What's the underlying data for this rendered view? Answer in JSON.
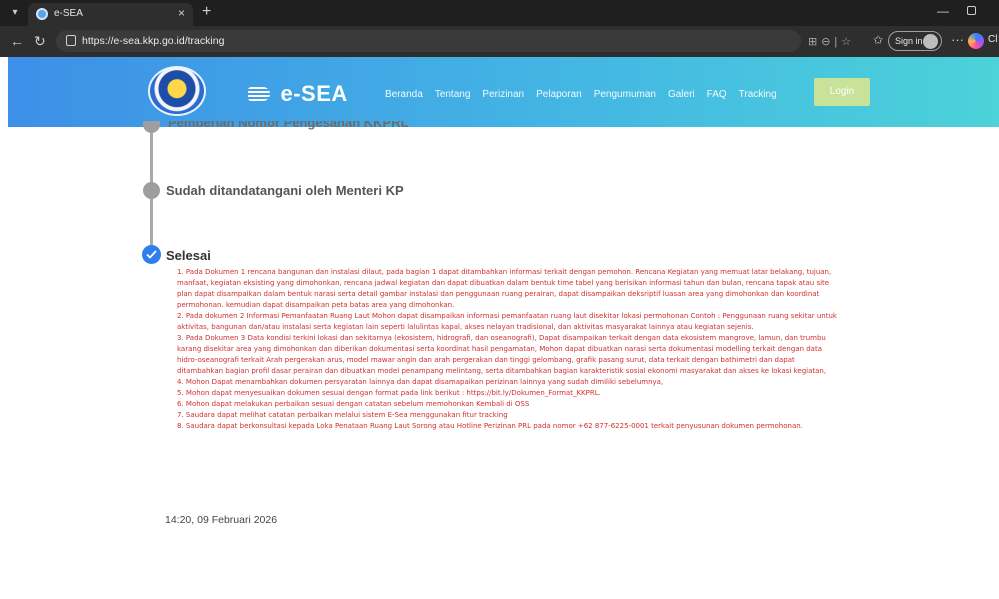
{
  "browser": {
    "tab_title": "e-SEA",
    "tab_close": "×",
    "new_tab": "+",
    "url": "https://e-sea.kkp.go.id/tracking",
    "signin_label": "Sign in",
    "copilot_label": "Cl"
  },
  "header": {
    "brand": "e-SEA",
    "nav": [
      "Beranda",
      "Tentang",
      "Perizinan",
      "Pelaporan",
      "Pengumuman",
      "Galeri",
      "FAQ",
      "Tracking"
    ],
    "login_label": "Login",
    "colors": {
      "gradient_start": "#3d8fe7",
      "gradient_end": "#4cd2d9",
      "login": "#c8e29a"
    }
  },
  "timeline": {
    "prev_step": "Pemberian Nomor Pengesahan KKPRL",
    "step_signed": "Sudah ditandatangani oleh Menteri KP",
    "step_done": "Selesai",
    "notes": [
      "1. Pada Dokumen 1 rencana bangunan dan instalasi dilaut, pada bagian 1 dapat ditambahkan informasi terkait dengan pemohon. Rencana Kegiatan yang memuat latar belakang, tujuan,",
      "manfaat, kegiatan eksisting yang dimohonkan, rencana jadwal kegiatan dan dapat dibuatkan dalam bentuk time tabel yang berisikan informasi tahun dan bulan, rencana tapak atau site",
      "plan dapat disampaikan dalam bentuk narasi serta detail gambar instalasi dan penggunaan ruang perairan, dapat disampaikan deksriptif luasan area yang dimohonkan dan koordinat",
      "permohonan. kemudian dapat disampaikan peta batas area yang dimohonkan.",
      "2. Pada dokumen 2 Informasi Pemanfaatan Ruang Laut Mohon dapat disampaikan informasi pemanfaatan ruang laut disekitar lokasi permohonan Contoh : Penggunaan ruang sekitar untuk",
      "aktivitas, bangunan dan/atau instalasi serta kegiatan lain seperti lalulintas kapal, akses nelayan tradisional, dan aktivitas masyarakat lainnya atau kegiatan sejenis.",
      "3. Pada Dokumen 3 Data kondisi terkini lokasi dan sekitarnya (ekosistem, hidrografi, dan oseanografi), Dapat disampaikan terkait dengan data ekosistem mangrove, lamun, dan trumbu",
      "karang disekitar area yang dimohonkan dan diberikan dokumentasi serta koordinat hasil pengamatan, Mohon dapat dibuatkan narasi serta dokumentasi modelling terkait dengan data",
      "hidro-oseanografi terkait Arah pergerakan arus, model mawar angin dan arah pergerakan dan tinggi gelombang, grafik pasang surut, data terkait dengan bathimetri dan dapat",
      "ditambahkan bagian profil dasar perairan dan dibuatkan model penampang melintang, serta ditambahkan bagian karakteristik sosial ekonomi masyarakat dan akses ke lokasi kegiatan,",
      "4. Mohon Dapat menambahkan dokumen persyaratan lainnya dan dapat disamapaikan perizinan lainnya yang sudah dimiliki sebelumnya,",
      "5. Mohon dapat menyesuaikan dokumen sesuai dengan format pada link berikut : https://bit.ly/Dokumen_Format_KKPRL.",
      "6. Mohon dapat melakukan perbaikan sesuai dengan catatan sebelum memohonkan Kembali di OSS",
      "7. Saudara dapat melihat catatan perbaikan melalui sistem E-Sea menggunakan fitur tracking",
      "8. Saudara dapat berkonsultasi kepada Loka Penataan Ruang Laut Sorong atau Hotline Perizinan PRL pada nomor +62 877-6225-0001 terkait penyusunan dokumen permohonan."
    ],
    "timestamp": "14:20, 09 Februari 2026",
    "colors": {
      "done": "#2f7ef0",
      "pending": "#9e9e9e",
      "note_text": "#d32f2f"
    }
  }
}
